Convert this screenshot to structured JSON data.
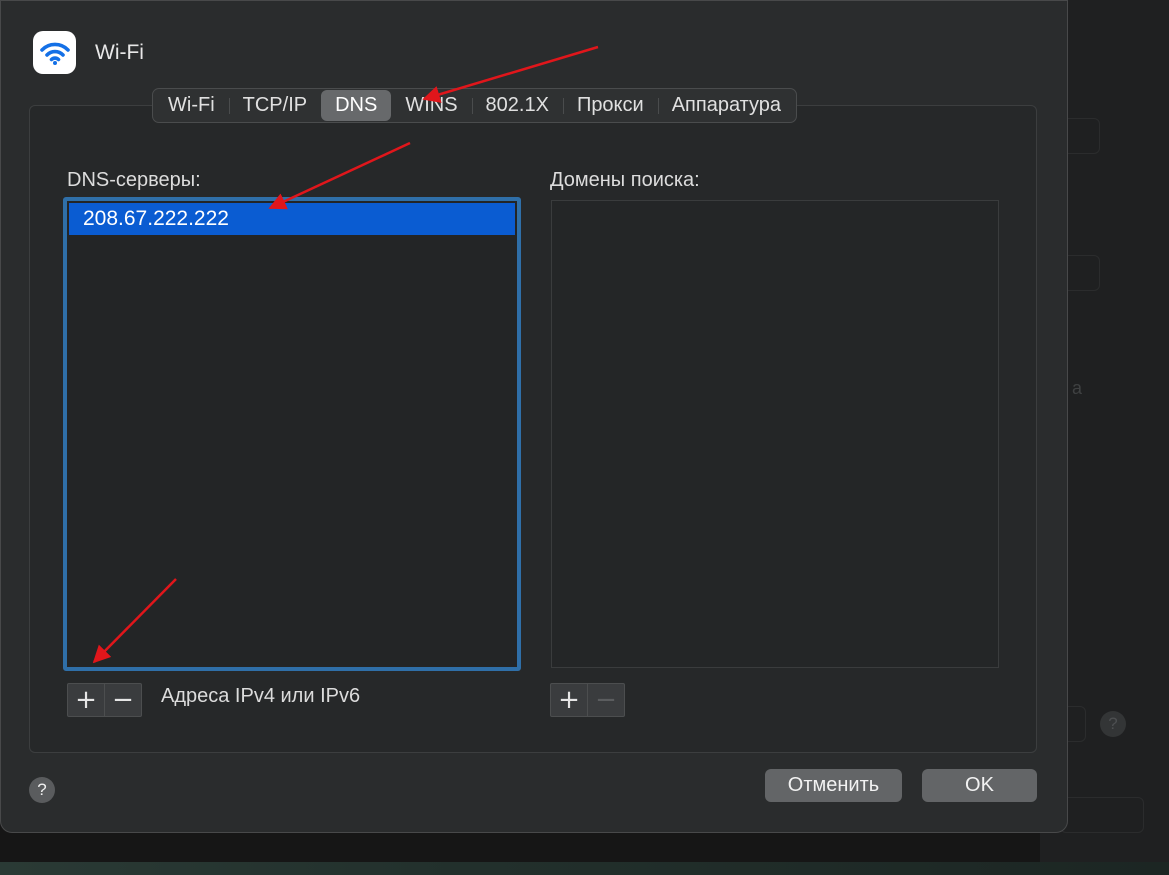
{
  "window": {
    "title": "Wi-Fi",
    "icon": "wifi-icon"
  },
  "tabs": [
    {
      "label": "Wi-Fi",
      "active": false
    },
    {
      "label": "TCP/IP",
      "active": false
    },
    {
      "label": "DNS",
      "active": true
    },
    {
      "label": "WINS",
      "active": false
    },
    {
      "label": "802.1X",
      "active": false
    },
    {
      "label": "Прокси",
      "active": false
    },
    {
      "label": "Аппаратура",
      "active": false
    }
  ],
  "dns": {
    "label": "DNS-серверы:",
    "servers": [
      "208.67.222.222"
    ],
    "hint": "Адреса IPv4 или IPv6",
    "add": "+",
    "remove": "−"
  },
  "search_domains": {
    "label": "Домены поиска:",
    "add": "+",
    "remove": "−"
  },
  "footer": {
    "help": "?",
    "cancel": "Отменить",
    "ok": "OK"
  },
  "colors": {
    "accent": "#0a5cd2",
    "focus_ring": "#2f6fa8",
    "annotation_arrow": "#e0161b"
  }
}
